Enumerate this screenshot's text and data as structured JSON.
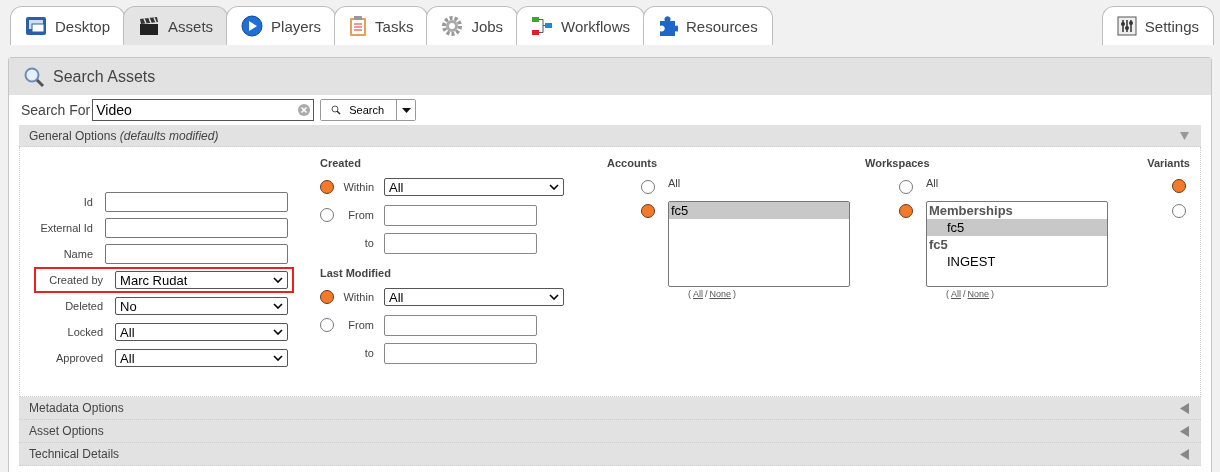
{
  "tabs": [
    {
      "label": "Desktop",
      "kind": "desktop",
      "selected": false
    },
    {
      "label": "Assets",
      "kind": "clapper",
      "selected": true
    },
    {
      "label": "Players",
      "kind": "play",
      "selected": false
    },
    {
      "label": "Tasks",
      "kind": "clipboard",
      "selected": false
    },
    {
      "label": "Jobs",
      "kind": "gear",
      "selected": false
    },
    {
      "label": "Workflows",
      "kind": "flow",
      "selected": false
    },
    {
      "label": "Resources",
      "kind": "puzzle",
      "selected": false
    }
  ],
  "settings_tab": {
    "label": "Settings",
    "selected": false
  },
  "panel": {
    "title": "Search Assets"
  },
  "search": {
    "label": "Search For",
    "value": "Video",
    "button": "Search"
  },
  "general": {
    "title": "General Options",
    "note": "(defaults modified)",
    "expanded": true
  },
  "fields": [
    {
      "label": "Id",
      "kind": "text",
      "highlighted": false
    },
    {
      "label": "External Id",
      "kind": "text",
      "highlighted": false
    },
    {
      "label": "Name",
      "kind": "text",
      "highlighted": false
    },
    {
      "label": "Created by",
      "kind": "select",
      "value": "Marc Rudat",
      "highlighted": true
    },
    {
      "label": "Deleted",
      "kind": "select",
      "value": "No",
      "highlighted": false
    },
    {
      "label": "Locked",
      "kind": "select",
      "value": "All",
      "highlighted": false
    },
    {
      "label": "Approved",
      "kind": "select",
      "value": "All",
      "highlighted": false
    }
  ],
  "date_groups": [
    {
      "title": "Created",
      "rows": [
        {
          "kind": "within",
          "label": "Within",
          "selected": true,
          "value": "All"
        },
        {
          "kind": "range",
          "label": "From",
          "selected": false,
          "to_label": "to"
        }
      ]
    },
    {
      "title": "Last Modified",
      "rows": [
        {
          "kind": "within",
          "label": "Within",
          "selected": true,
          "value": "All"
        },
        {
          "kind": "range",
          "label": "From",
          "selected": false,
          "to_label": "to"
        }
      ]
    }
  ],
  "pickers": [
    {
      "title": "Accounts",
      "all_label": "All",
      "all_selected": false,
      "list_selected": true,
      "items": [
        {
          "label": "fc5",
          "kind": "plain",
          "selected": true
        }
      ],
      "links": [
        {
          "kind": "text",
          "text": "("
        },
        {
          "kind": "link",
          "text": "All"
        },
        {
          "kind": "text",
          "text": "/"
        },
        {
          "kind": "link",
          "text": "None"
        },
        {
          "kind": "text",
          "text": ")"
        }
      ]
    },
    {
      "title": "Workspaces",
      "all_label": "All",
      "all_selected": false,
      "list_selected": true,
      "items": [
        {
          "label": "Memberships",
          "kind": "group",
          "selected": false
        },
        {
          "label": "fc5",
          "kind": "option",
          "selected": true
        },
        {
          "label": "fc5",
          "kind": "group",
          "selected": false
        },
        {
          "label": "INGEST",
          "kind": "option",
          "selected": false
        }
      ],
      "links": [
        {
          "kind": "text",
          "text": "("
        },
        {
          "kind": "link",
          "text": "All"
        },
        {
          "kind": "text",
          "text": "/"
        },
        {
          "kind": "link",
          "text": "None"
        },
        {
          "kind": "text",
          "text": ")"
        }
      ]
    }
  ],
  "variants": {
    "title": "Variants",
    "options": [
      {
        "selected": true
      },
      {
        "selected": false
      }
    ]
  },
  "sections": [
    {
      "title": "Metadata Options",
      "expanded": false
    },
    {
      "title": "Asset Options",
      "expanded": false
    },
    {
      "title": "Technical Details",
      "expanded": false
    }
  ]
}
